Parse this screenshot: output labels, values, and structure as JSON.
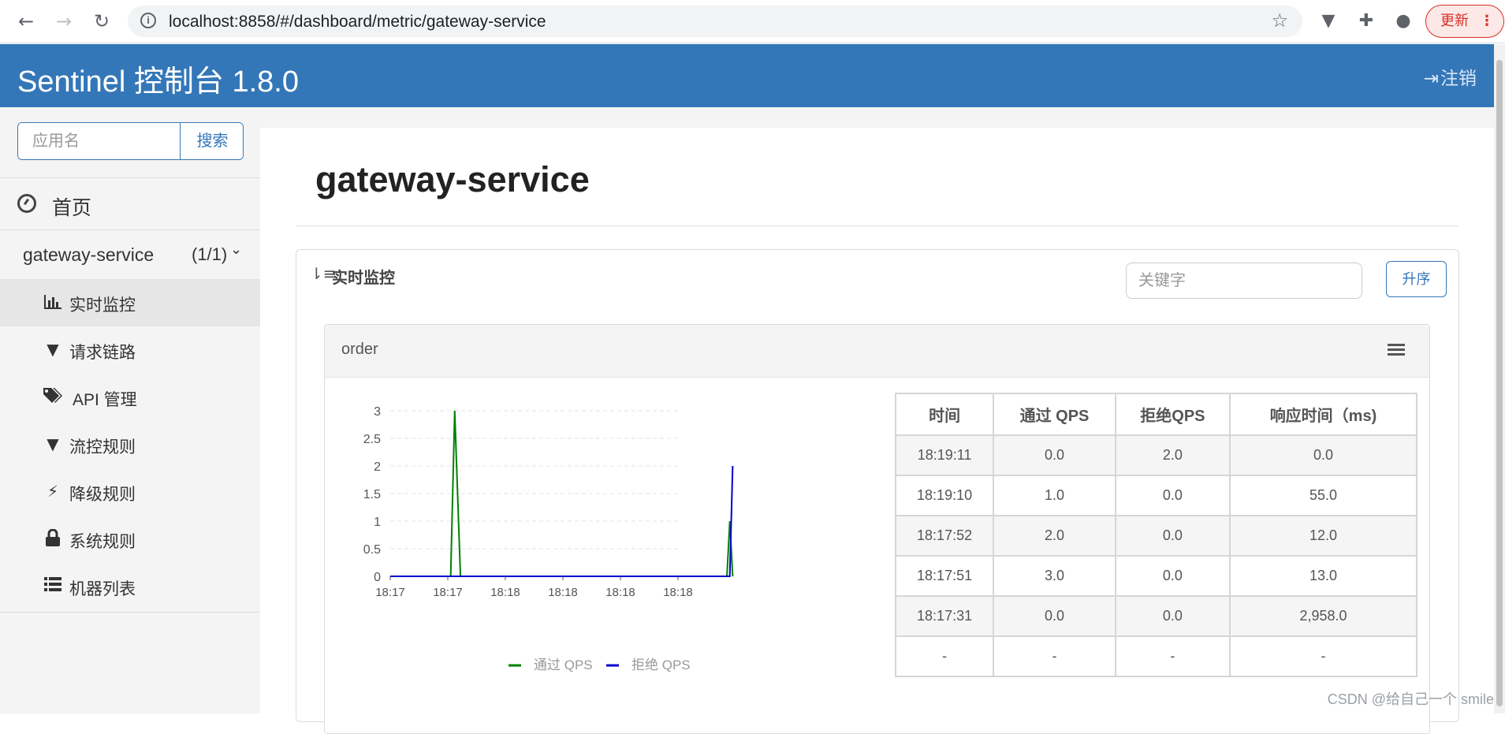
{
  "browser": {
    "url": "localhost:8858/#/dashboard/metric/gateway-service",
    "update_label": "更新"
  },
  "app": {
    "title": "Sentinel 控制台 1.8.0",
    "logout_label": "注销"
  },
  "sidebar": {
    "search_placeholder": "应用名",
    "search_button": "搜索",
    "home_label": "首页",
    "app_name": "gateway-service",
    "app_count": "(1/1)",
    "items": [
      {
        "label": "实时监控",
        "icon": "bar-chart-icon",
        "active": true
      },
      {
        "label": "请求链路",
        "icon": "filter-icon",
        "active": false
      },
      {
        "label": "API 管理",
        "icon": "tags-icon",
        "active": false
      },
      {
        "label": "流控规则",
        "icon": "filter-icon",
        "active": false
      },
      {
        "label": "降级规则",
        "icon": "bolt-icon",
        "active": false
      },
      {
        "label": "系统规则",
        "icon": "lock-icon",
        "active": false
      },
      {
        "label": "机器列表",
        "icon": "list-icon",
        "active": false
      }
    ]
  },
  "main": {
    "page_title": "gateway-service",
    "panel_title": "实时监控",
    "keyword_placeholder": "关键字",
    "sort_button": "升序",
    "card_title": "order"
  },
  "chart_data": {
    "type": "line",
    "x_tick_labels": [
      "18:17",
      "18:17",
      "18:18",
      "18:18",
      "18:18",
      "18:18"
    ],
    "yticks": [
      0,
      0.5,
      1,
      1.5,
      2,
      2.5,
      3
    ],
    "ylim": [
      0,
      3
    ],
    "grid": true,
    "legend_position": "bottom",
    "series": [
      {
        "name": "通过 QPS",
        "color": "#008000",
        "points": [
          [
            0,
            0
          ],
          [
            1.05,
            0
          ],
          [
            1.12,
            3
          ],
          [
            1.22,
            0
          ],
          [
            5.85,
            0
          ],
          [
            5.9,
            1
          ],
          [
            5.95,
            0
          ]
        ]
      },
      {
        "name": "拒绝 QPS",
        "color": "#0000cc",
        "points": [
          [
            0,
            0
          ],
          [
            5.9,
            0
          ],
          [
            5.95,
            2
          ]
        ]
      }
    ]
  },
  "table": {
    "headers": [
      "时间",
      "通过 QPS",
      "拒绝QPS",
      "响应时间（ms)"
    ],
    "rows": [
      [
        "18:19:11",
        "0.0",
        "2.0",
        "0.0"
      ],
      [
        "18:19:10",
        "1.0",
        "0.0",
        "55.0"
      ],
      [
        "18:17:52",
        "2.0",
        "0.0",
        "12.0"
      ],
      [
        "18:17:51",
        "3.0",
        "0.0",
        "13.0"
      ],
      [
        "18:17:31",
        "0.0",
        "0.0",
        "2,958.0"
      ],
      [
        "-",
        "-",
        "-",
        "-"
      ]
    ]
  },
  "watermark": "CSDN @给自己一个 smile"
}
